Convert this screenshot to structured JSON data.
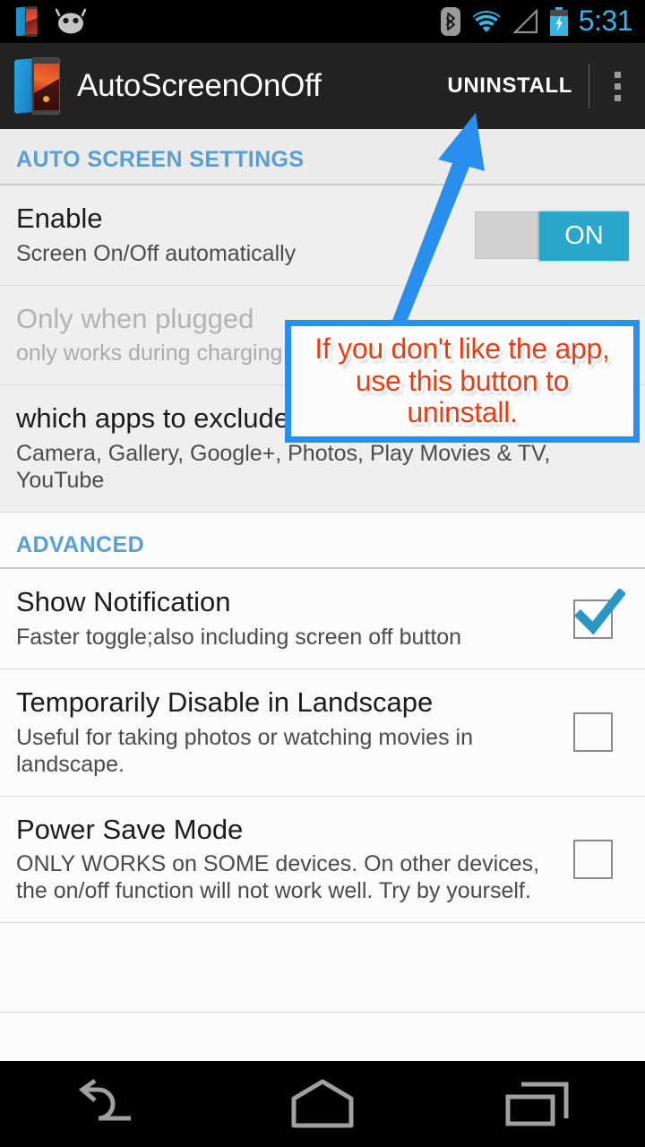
{
  "status_bar": {
    "icons": [
      "app-notification-icon",
      "jelly-bean-icon",
      "bluetooth-icon",
      "wifi-icon",
      "cellular-signal-icon",
      "battery-charging-icon"
    ],
    "clock": "5:31",
    "clock_color": "#33b5e5"
  },
  "action_bar": {
    "app_icon": "autoscreenonoff-app-icon",
    "title": "AutoScreenOnOff",
    "uninstall_label": "UNINSTALL",
    "overflow_label": "overflow-menu",
    "background": "#222222"
  },
  "sections": [
    {
      "header": "AUTO SCREEN SETTINGS",
      "header_color": "#5a9fd4",
      "rows": [
        {
          "title": "Enable",
          "subtitle": "Screen On/Off automatically",
          "control": "toggle",
          "toggle_label": "ON",
          "toggle_on": true,
          "disabled": false
        },
        {
          "title": "Only when plugged",
          "subtitle": "only works during charging",
          "control": "none",
          "disabled": true
        },
        {
          "title": "which apps to exclude",
          "subtitle": "Camera, Gallery, Google+, Photos, Play Movies & TV, YouTube",
          "control": "none",
          "disabled": false
        }
      ]
    },
    {
      "header": "ADVANCED",
      "header_color": "#5a9fd4",
      "rows": [
        {
          "title": "Show Notification",
          "subtitle": "Faster toggle;also including screen off button",
          "control": "checkbox",
          "checked": true,
          "disabled": false
        },
        {
          "title": "Temporarily Disable in Landscape",
          "subtitle": "Useful for taking photos or watching movies in landscape.",
          "control": "checkbox",
          "checked": false,
          "disabled": false
        },
        {
          "title": "Power Save Mode",
          "subtitle": "ONLY WORKS on SOME devices. On other devices, the on/off function will not work well. Try by yourself.",
          "control": "checkbox",
          "checked": false,
          "disabled": false
        }
      ]
    }
  ],
  "annotation": {
    "text": "If you don't like the app, use this button to uninstall.",
    "text_color": "#ef3b11",
    "border_color": "#2a8fec",
    "arrow_color": "#2a8fec",
    "points_at": "UNINSTALL"
  },
  "nav_bar": {
    "buttons": [
      "back-button",
      "home-button",
      "recents-button"
    ],
    "icon_color": "#a0a0a0"
  },
  "accent_colors": {
    "toggle_on": "#2ba6cb",
    "checkbox_tick": "#2b96c4",
    "section_header": "#5a9fd4"
  }
}
